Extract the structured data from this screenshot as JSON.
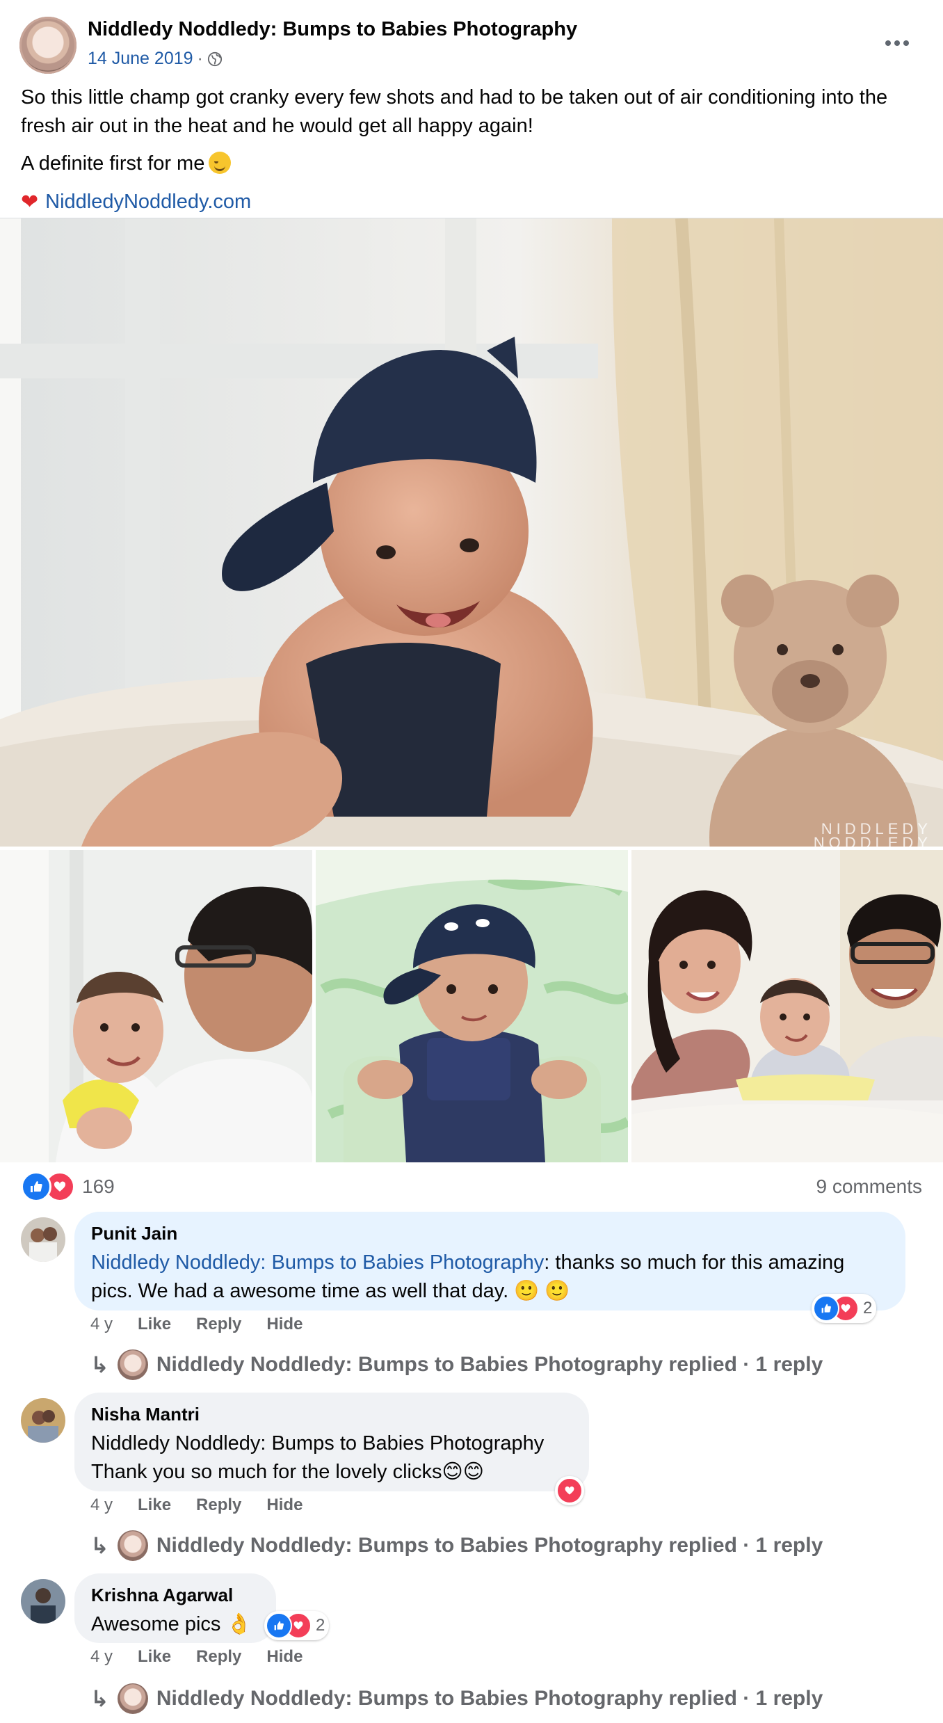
{
  "post": {
    "author": "Niddledy Noddledy: Bumps to Babies Photography",
    "date": "14 June 2019",
    "date_sep": "·",
    "text": "So this little champ got cranky every few shots and had to be taken out of air conditioning into the fresh air out in the heat and he would get all happy again!",
    "text2": "A definite first for me",
    "link": "NiddledyNoddledy.com",
    "watermark": "NIDDLEDY NODDLEDY"
  },
  "stats": {
    "reaction_count": "169",
    "comments": "9 comments"
  },
  "comments": [
    {
      "author": "Punit Jain",
      "mention": "Niddledy Noddledy: Bumps to Babies Photography",
      "text": ": thanks so much for this amazing pics. We had a awesome time as well that day. 🙂 🙂",
      "age": "4 y",
      "like": "Like",
      "reply": "Reply",
      "hide": "Hide",
      "reactions": "2",
      "reply_summary": "Niddledy Noddledy: Bumps to Babies Photography replied · 1 reply"
    },
    {
      "author": "Nisha Mantri",
      "mention": "Niddledy Noddledy: Bumps to Babies Photography",
      "text": "Thank you so much for the lovely clicks😊😊",
      "age": "4 y",
      "like": "Like",
      "reply": "Reply",
      "hide": "Hide",
      "reply_summary": "Niddledy Noddledy: Bumps to Babies Photography replied · 1 reply"
    },
    {
      "author": "Krishna Agarwal",
      "text": "Awesome pics 👌",
      "age": "4 y",
      "like": "Like",
      "reply": "Reply",
      "hide": "Hide",
      "reactions": "2",
      "reply_summary": "Niddledy Noddledy: Bumps to Babies Photography replied · 1 reply"
    }
  ],
  "colors": {
    "link": "#1f5aa6",
    "like_blue": "#1877f2",
    "love_red": "#f33e58",
    "secondary_text": "#65676b"
  }
}
